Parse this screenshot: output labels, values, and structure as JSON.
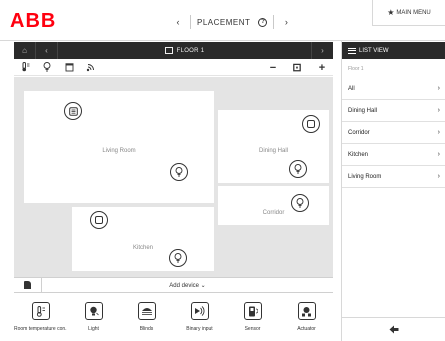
{
  "header": {
    "logo": "ABB",
    "title": "PLACEMENT",
    "prev_glyph": "‹",
    "next_glyph": "›",
    "help_glyph": "?",
    "main_menu_label": "MAIN MENU"
  },
  "floor_bar": {
    "title": "FLOOR 1"
  },
  "toolbar": {
    "zoom_out": "−",
    "fit": "⊡",
    "zoom_in": "+"
  },
  "rooms": [
    {
      "label": "Living Room"
    },
    {
      "label": "Dining Hall"
    },
    {
      "label": "Corridor"
    },
    {
      "label": "Kitchen"
    }
  ],
  "add_device": {
    "label": "Add device ⌄"
  },
  "palette": [
    {
      "label": "Room temperature con...",
      "icon": "thermostat-icon"
    },
    {
      "label": "Light",
      "icon": "light-icon"
    },
    {
      "label": "Blinds",
      "icon": "blinds-icon"
    },
    {
      "label": "Binary input",
      "icon": "binary-input-icon"
    },
    {
      "label": "Sensor",
      "icon": "sensor-icon"
    },
    {
      "label": "Actuator",
      "icon": "actuator-icon"
    }
  ],
  "side_panel": {
    "list_view_label": "LIST VIEW",
    "floor_label": "Floor 1",
    "items": [
      {
        "label": "All"
      },
      {
        "label": "Dining Hall"
      },
      {
        "label": "Corridor"
      },
      {
        "label": "Kitchen"
      },
      {
        "label": "Living Room"
      }
    ],
    "arrow": "›",
    "back_glyph": "🡄"
  },
  "colors": {
    "brand": "#ff000f",
    "dark_bar": "#2a2a2a",
    "canvas": "#e4e4e4"
  }
}
